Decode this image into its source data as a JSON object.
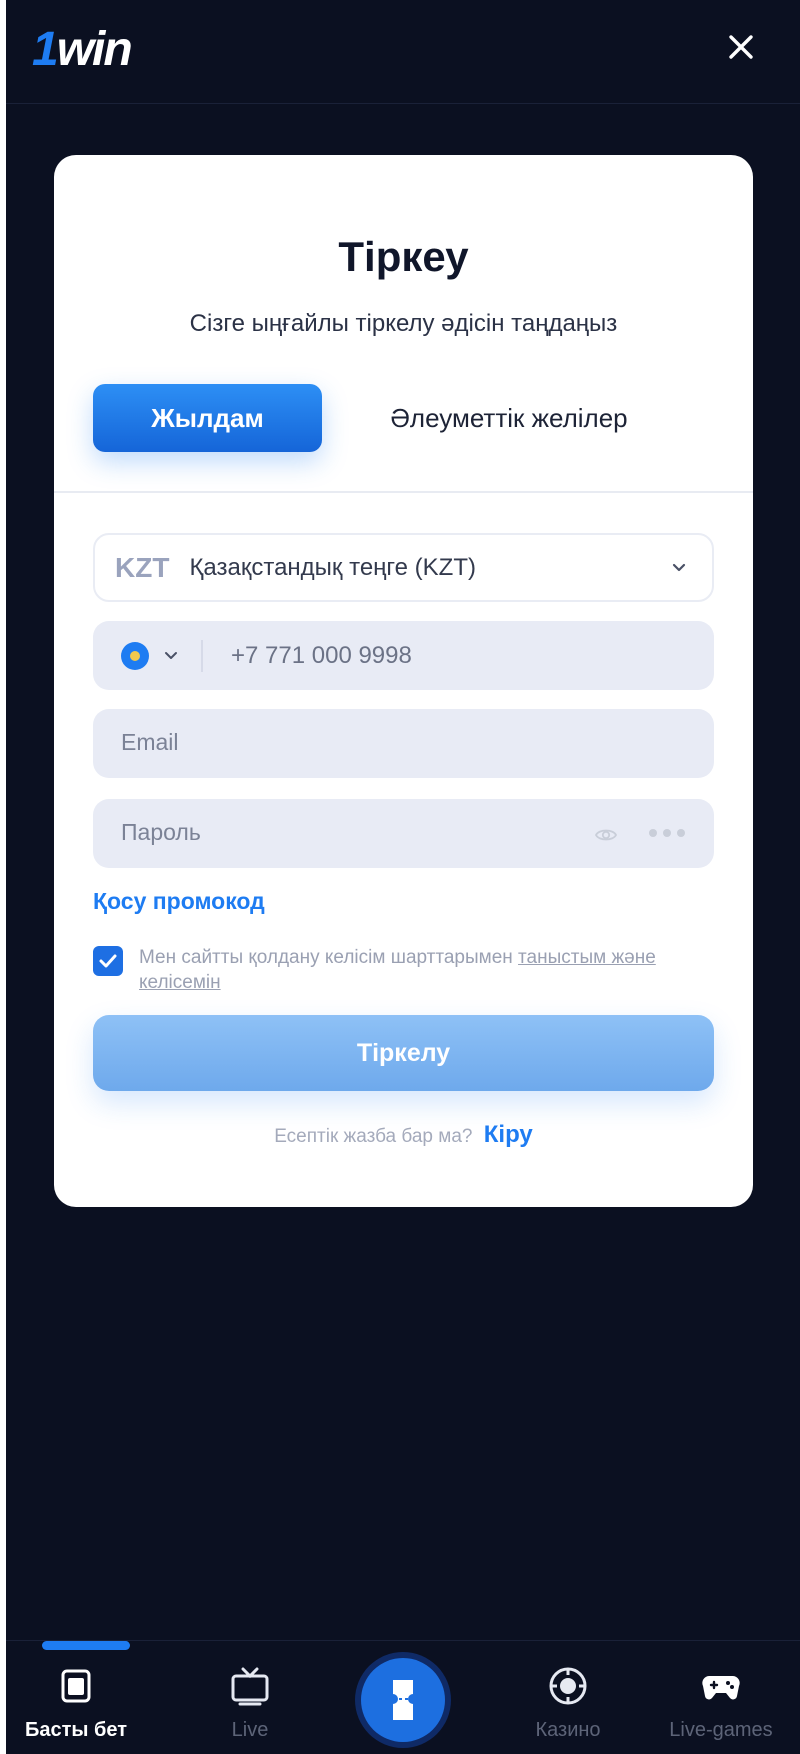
{
  "header": {
    "logo_one": "1",
    "logo_win": "win",
    "close_icon": "close-icon"
  },
  "card": {
    "title": "Тіркеу",
    "subtitle": "Сізге ыңғайлы тіркелу әдісін таңдаңыз",
    "tabs": [
      {
        "label": "Жылдам",
        "active": true
      },
      {
        "label": "Әлеуметтік желілер",
        "active": false
      }
    ],
    "currency": {
      "code": "KZT",
      "name": "Қазақстандық теңге (KZT)"
    },
    "phone": {
      "placeholder": "+7 771 000 9998"
    },
    "email": {
      "placeholder": "Email"
    },
    "password": {
      "placeholder": "Пароль"
    },
    "promo_link": "Қосу промокод",
    "agreement": {
      "checked": true,
      "text": "Мен сайтты қолдану келісім шарттарымен ",
      "link": "таныстым және келісемін"
    },
    "submit_label": "Тіркелу",
    "login_prompt": "Есептік жазба бар ма?",
    "login_link": "Кіру"
  },
  "bottom_nav": {
    "items": [
      {
        "label": "Басты бет",
        "icon": "home-icon",
        "active": true
      },
      {
        "label": "Live",
        "icon": "tv-icon",
        "active": false
      },
      {
        "label": "",
        "icon": "ticket-icon",
        "active": false
      },
      {
        "label": "Казино",
        "icon": "casino-chip-icon",
        "active": false
      },
      {
        "label": "Live-games",
        "icon": "gamepad-icon",
        "active": false
      }
    ]
  },
  "colors": {
    "background": "#0b1021",
    "accent": "#1e7cf2",
    "card": "#ffffff",
    "submit_disabled": "#7fb4f0"
  }
}
